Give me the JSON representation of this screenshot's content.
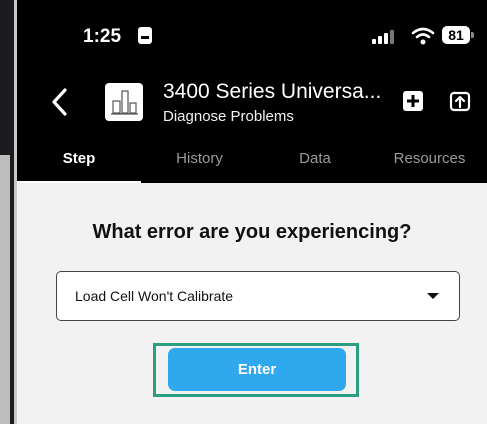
{
  "status_bar": {
    "time": "1:25",
    "battery": "81"
  },
  "header": {
    "title": "3400 Series Universa...",
    "subtitle": "Diagnose Problems"
  },
  "tabs": [
    {
      "label": "Step",
      "active": true
    },
    {
      "label": "History",
      "active": false
    },
    {
      "label": "Data",
      "active": false
    },
    {
      "label": "Resources",
      "active": false
    }
  ],
  "main": {
    "question": "What error are you experiencing?",
    "selected_error": "Load Cell Won't Calibrate",
    "enter_label": "Enter"
  },
  "colors": {
    "accent": "#2fa8ee",
    "highlight": "#2e9e83"
  }
}
